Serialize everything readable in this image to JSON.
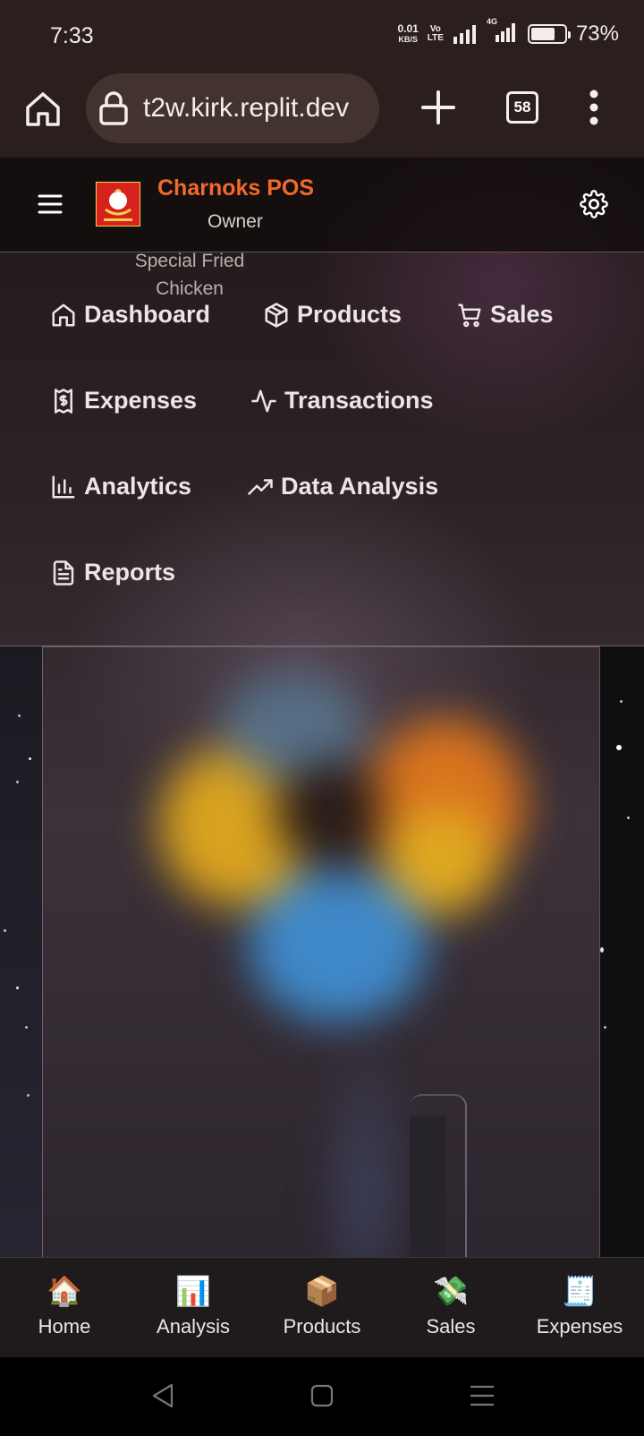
{
  "status_bar": {
    "time": "7:33",
    "net_speed_value": "0.01",
    "net_speed_unit": "KB/S",
    "volte_top": "Vo",
    "volte_bottom": "LTE",
    "network_type": "4G",
    "battery_percent": "73%",
    "battery_level": 0.73
  },
  "browser": {
    "url": "t2w.kirk.replit.dev",
    "tab_count": "58"
  },
  "app": {
    "title": "Charnoks POS",
    "role": "Owner",
    "tagline": "Special Fried Chicken",
    "title_color": "#ef6a2b"
  },
  "nav": {
    "items": [
      {
        "label": "Dashboard",
        "icon": "home-icon"
      },
      {
        "label": "Products",
        "icon": "box-icon"
      },
      {
        "label": "Sales",
        "icon": "cart-icon"
      },
      {
        "label": "Expenses",
        "icon": "receipt-dollar-icon"
      },
      {
        "label": "Transactions",
        "icon": "activity-icon"
      },
      {
        "label": "Analytics",
        "icon": "bar-chart-icon"
      },
      {
        "label": "Data Analysis",
        "icon": "trending-up-icon"
      },
      {
        "label": "Reports",
        "icon": "file-text-icon"
      }
    ]
  },
  "bottom_nav": {
    "items": [
      {
        "label": "Home",
        "icon": "🏠"
      },
      {
        "label": "Analysis",
        "icon": "📊"
      },
      {
        "label": "Products",
        "icon": "📦"
      },
      {
        "label": "Sales",
        "icon": "💸"
      },
      {
        "label": "Expenses",
        "icon": "🧾"
      }
    ]
  }
}
